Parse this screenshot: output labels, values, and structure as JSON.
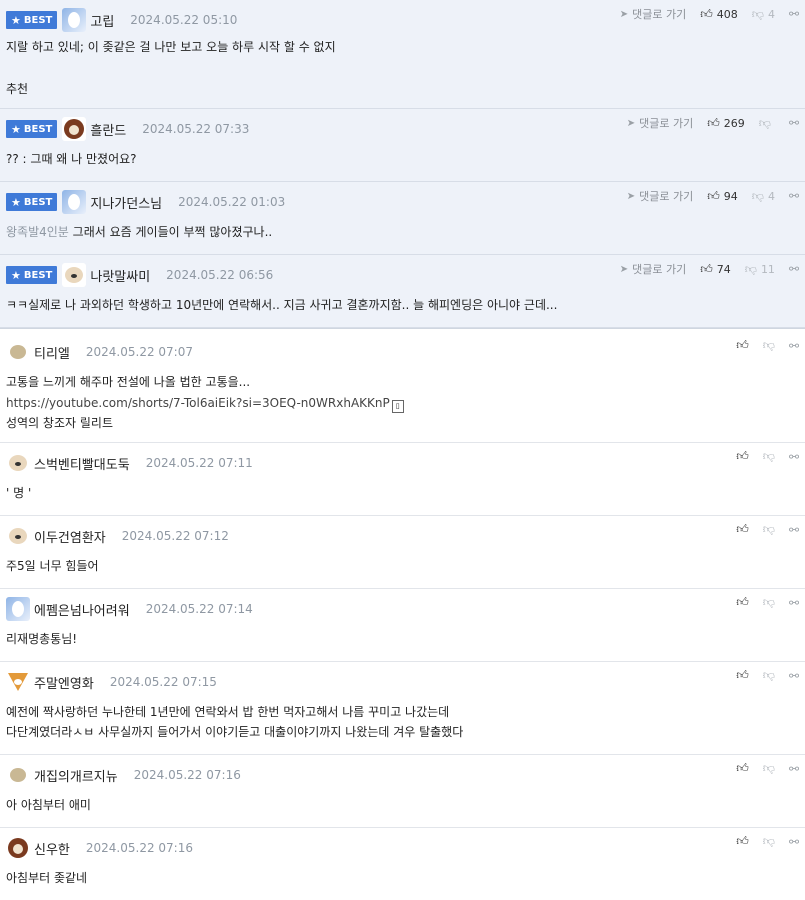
{
  "best_badge": "BEST",
  "goto_label": "댓글로 가기",
  "best_comments": [
    {
      "nick": "고립",
      "date": "2024.05.22 05:10",
      "likes": "408",
      "dislikes": "4",
      "text": "지랄 하고 있네; 이 좆같은 걸 나만 보고 오늘 하루 시작 할 수 없지",
      "extra": "추천"
    },
    {
      "nick": "흘란드",
      "date": "2024.05.22 07:33",
      "likes": "269",
      "dislikes": "",
      "text": "?? : 그때 왜 나 만졌어요?"
    },
    {
      "nick": "지나가던스님",
      "date": "2024.05.22 01:03",
      "likes": "94",
      "dislikes": "4",
      "prefix": "왕족발4인분",
      "text": "그래서 요즘 게이들이 부쩍 많아졌구나.."
    },
    {
      "nick": "나랏말싸미",
      "date": "2024.05.22 06:56",
      "likes": "74",
      "dislikes": "11",
      "text": "ㅋㅋ실제로 나 과외하던 학생하고 10년만에 연락해서.. 지금 사귀고 결혼까지함.. 늘 해피엔딩은 아니야 근데..."
    }
  ],
  "comments": [
    {
      "nick": "티리엘",
      "date": "2024.05.22 07:07",
      "lines": [
        "고통을 느끼게 해주마 전설에 나올 법한 고통을...",
        "https://youtube.com/shorts/7-Tol6aiEik?si=3OEQ-n0WRxhAKKnP",
        "성역의 창조자 릴리트"
      ]
    },
    {
      "nick": "스벅벤티빨대도둑",
      "date": "2024.05.22 07:11",
      "lines": [
        "' 명 '"
      ]
    },
    {
      "nick": "이두건염환자",
      "date": "2024.05.22 07:12",
      "lines": [
        "주5일 너무 힘들어"
      ]
    },
    {
      "nick": "에펨은넘나어려워",
      "date": "2024.05.22 07:14",
      "lines": [
        "리재명총통님!"
      ]
    },
    {
      "nick": "주말엔영화",
      "date": "2024.05.22 07:15",
      "lines": [
        "예전에 짝사랑하던 누나한테 1년만에 연락와서 밥 한번 먹자고해서 나름 꾸미고 나갔는데",
        "다단계였더라ㅅㅂ 사무실까지 들어가서 이야기듣고 대출이야기까지 나왔는데 겨우 탈출했다"
      ]
    },
    {
      "nick": "개집의개르지뉴",
      "date": "2024.05.22 07:16",
      "lines": [
        "아 아침부터 애미"
      ]
    },
    {
      "nick": "신우한",
      "date": "2024.05.22 07:16",
      "lines": [
        "아침부터 좆같네"
      ]
    }
  ]
}
